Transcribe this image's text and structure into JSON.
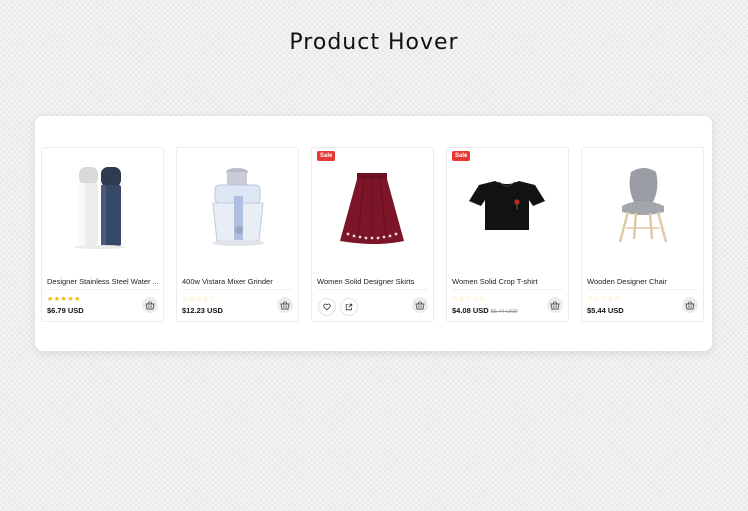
{
  "page": {
    "title": "Product Hover"
  },
  "products": [
    {
      "name": "Designer Stainless Steel Water ...",
      "rating": "★★★★★",
      "price": "$6.79 USD",
      "sale": "",
      "old_price": ""
    },
    {
      "name": "400w Vistara Mixer Grinder",
      "rating": "☆☆☆☆☆",
      "price": "$12.23 USD",
      "sale": "",
      "old_price": ""
    },
    {
      "name": "Women Solid Designer Skirts",
      "rating": "",
      "price": "",
      "sale": "Sale",
      "old_price": ""
    },
    {
      "name": "Women Solid Crop T-shirt",
      "rating": "☆☆☆☆☆",
      "price": "$4.08 USD",
      "sale": "Sale",
      "old_price": "$5.44 USD"
    },
    {
      "name": "Wooden Designer Chair",
      "rating": "☆☆☆☆☆",
      "price": "$5.44 USD",
      "sale": "",
      "old_price": ""
    }
  ],
  "icons": {
    "cart": "basket-icon",
    "wishlist": "heart-icon",
    "quick_view": "external-link-icon"
  },
  "colors": {
    "sale": "#e53935",
    "star": "#f5b301",
    "skirt": "#7d1528"
  }
}
